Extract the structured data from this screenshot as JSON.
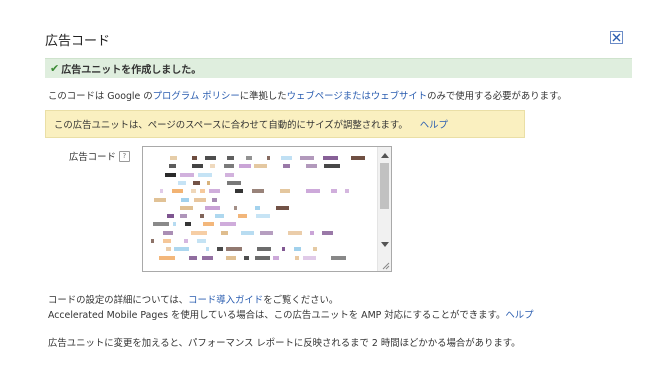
{
  "dialog": {
    "title": "広告コード",
    "close_icon": "close-icon"
  },
  "success": {
    "icon": "check-icon",
    "message": "広告ユニットを作成しました。"
  },
  "policy": {
    "prefix": "このコードは Google の",
    "program_policy_link": "プログラム ポリシー",
    "middle": "に準拠した",
    "webpage_link": "ウェブページまたはウェブサイト",
    "suffix": "のみで使用する必要があります。"
  },
  "info": {
    "text": "この広告ユニットは、ページのスペースに合わせて自動的にサイズが調整されます。",
    "help_link": "ヘルプ"
  },
  "code_field": {
    "label": "広告コード",
    "help_icon": "?"
  },
  "footer": {
    "guide_prefix": "コードの設定の詳細については、",
    "guide_link": "コード導入ガイド",
    "guide_suffix": "をご覧ください。",
    "amp_text": "Accelerated Mobile Pages を使用している場合は、この広告ユニットを AMP 対応にすることができます。",
    "amp_help_link": "ヘルプ",
    "reflect_notice": "広告ユニットに変更を加えると、パフォーマンス レポートに反映されるまで 2 時間ほどかかる場合があります。"
  },
  "colors": {
    "link": "#2a5db0",
    "success_bg": "#dfeede",
    "info_bg": "#faf0c0"
  }
}
